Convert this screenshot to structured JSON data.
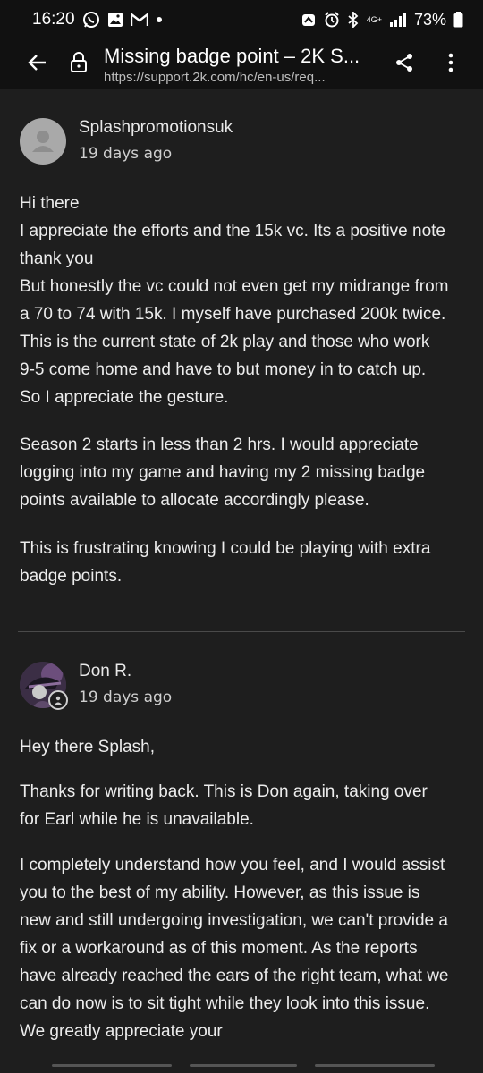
{
  "status_bar": {
    "time": "16:20",
    "network": "4G+",
    "battery": "73%"
  },
  "app_bar": {
    "title": "Missing badge point – 2K S...",
    "url": "https://support.2k.com/hc/en-us/req..."
  },
  "icons": [
    "whatsapp-icon",
    "gallery-icon",
    "gmail-icon",
    "dot-icon",
    "alarm-icon",
    "bluetooth-icon",
    "signal-icon",
    "battery-icon",
    "back-arrow-icon",
    "lock-icon",
    "share-icon",
    "more-vert-icon",
    "agent-icon"
  ],
  "comments": [
    {
      "author": "Splashpromotionsuk",
      "time": "19 days ago",
      "paragraphs": [
        "Hi there\nI appreciate the efforts and the 15k vc. Its a positive note thank you\nBut honestly the vc could not even get my midrange from a 70 to 74 with 15k. I myself have purchased 200k twice. This is the current state of 2k play and those who work 9-5 come home and have to but money in to catch up. So I appreciate the gesture.",
        "Season 2 starts in less than 2 hrs. I would appreciate logging into my game and having my 2 missing badge points available to allocate accordingly please.",
        "This is frustrating knowing I could be playing with extra badge points."
      ]
    },
    {
      "author": "Don R.",
      "time": "19 days ago",
      "paragraphs": [
        "Hey there Splash,",
        "Thanks for writing back. This is Don again, taking over for Earl while he is unavailable.",
        "I completely understand how you feel, and I would assist you to the best of my ability. However, as this issue is new and still undergoing investigation, we can't provide a fix or a workaround as of this moment. As the reports have already reached the ears of the right team, what we can do now is to sit tight while they look into this issue. We greatly appreciate your"
      ]
    }
  ]
}
